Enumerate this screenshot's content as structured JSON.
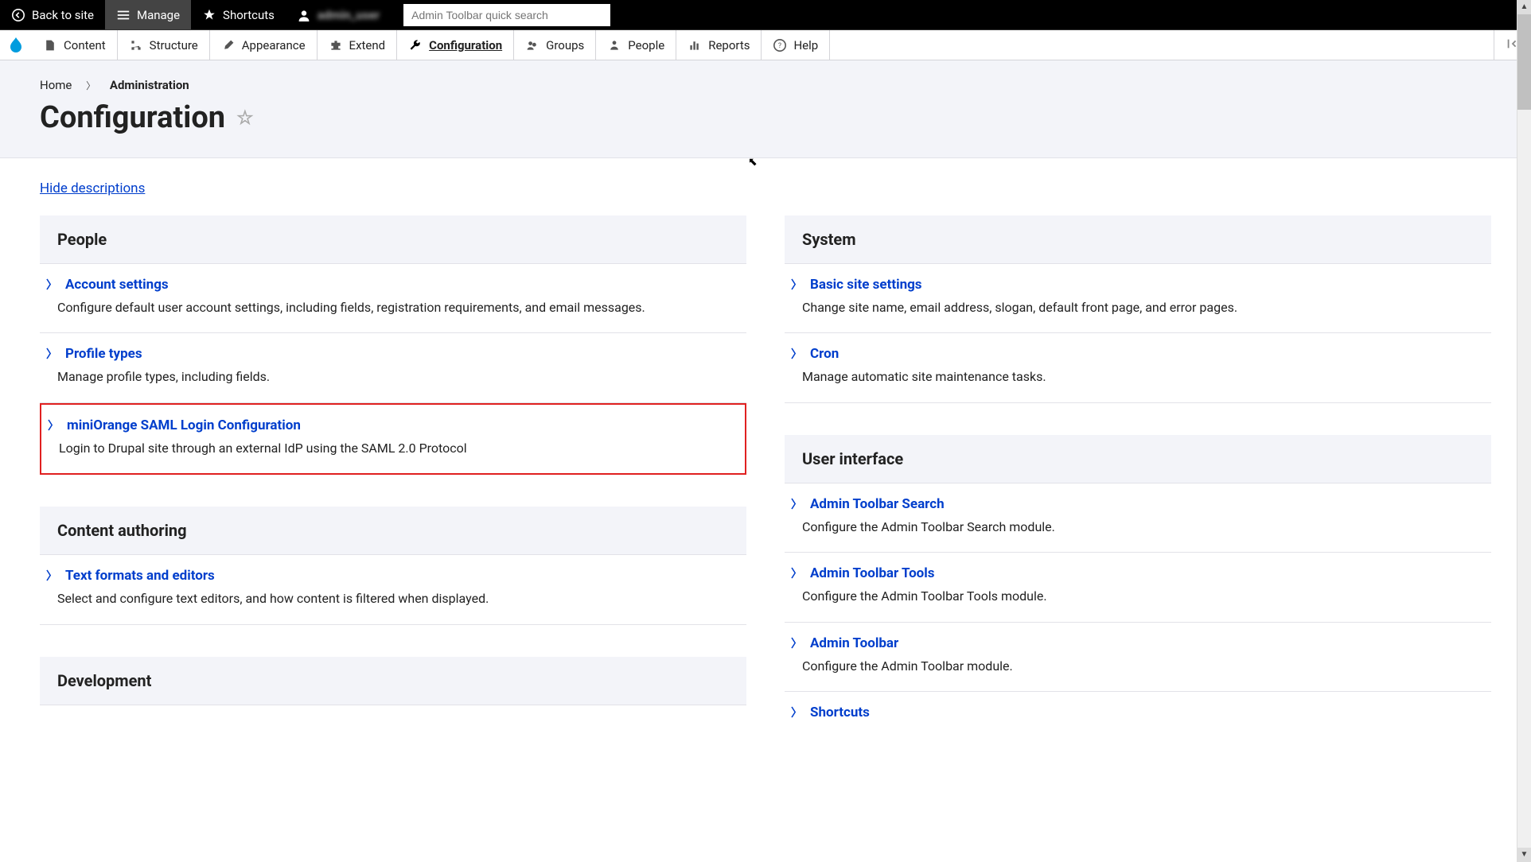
{
  "toolbar": {
    "back": "Back to site",
    "manage": "Manage",
    "shortcuts": "Shortcuts",
    "user": "admin_user",
    "search_placeholder": "Admin Toolbar quick search"
  },
  "admin_menu": {
    "content": "Content",
    "structure": "Structure",
    "appearance": "Appearance",
    "extend": "Extend",
    "configuration": "Configuration",
    "groups": "Groups",
    "people": "People",
    "reports": "Reports",
    "help": "Help"
  },
  "breadcrumb": {
    "home": "Home",
    "admin": "Administration"
  },
  "page_title": "Configuration",
  "hide_desc": "Hide descriptions",
  "panels": {
    "people": {
      "title": "People",
      "items": [
        {
          "label": "Account settings",
          "desc": "Configure default user account settings, including fields, registration requirements, and email messages."
        },
        {
          "label": "Profile types",
          "desc": "Manage profile types, including fields."
        },
        {
          "label": "miniOrange SAML Login Configuration",
          "desc": "Login to Drupal site through an external IdP using the SAML 2.0 Protocol"
        }
      ]
    },
    "content_authoring": {
      "title": "Content authoring",
      "items": [
        {
          "label": "Text formats and editors",
          "desc": "Select and configure text editors, and how content is filtered when displayed."
        }
      ]
    },
    "development": {
      "title": "Development",
      "items": []
    },
    "system": {
      "title": "System",
      "items": [
        {
          "label": "Basic site settings",
          "desc": "Change site name, email address, slogan, default front page, and error pages."
        },
        {
          "label": "Cron",
          "desc": "Manage automatic site maintenance tasks."
        }
      ]
    },
    "user_interface": {
      "title": "User interface",
      "items": [
        {
          "label": "Admin Toolbar Search",
          "desc": "Configure the Admin Toolbar Search module."
        },
        {
          "label": "Admin Toolbar Tools",
          "desc": "Configure the Admin Toolbar Tools module."
        },
        {
          "label": "Admin Toolbar",
          "desc": "Configure the Admin Toolbar module."
        },
        {
          "label": "Shortcuts",
          "desc": ""
        }
      ]
    }
  }
}
